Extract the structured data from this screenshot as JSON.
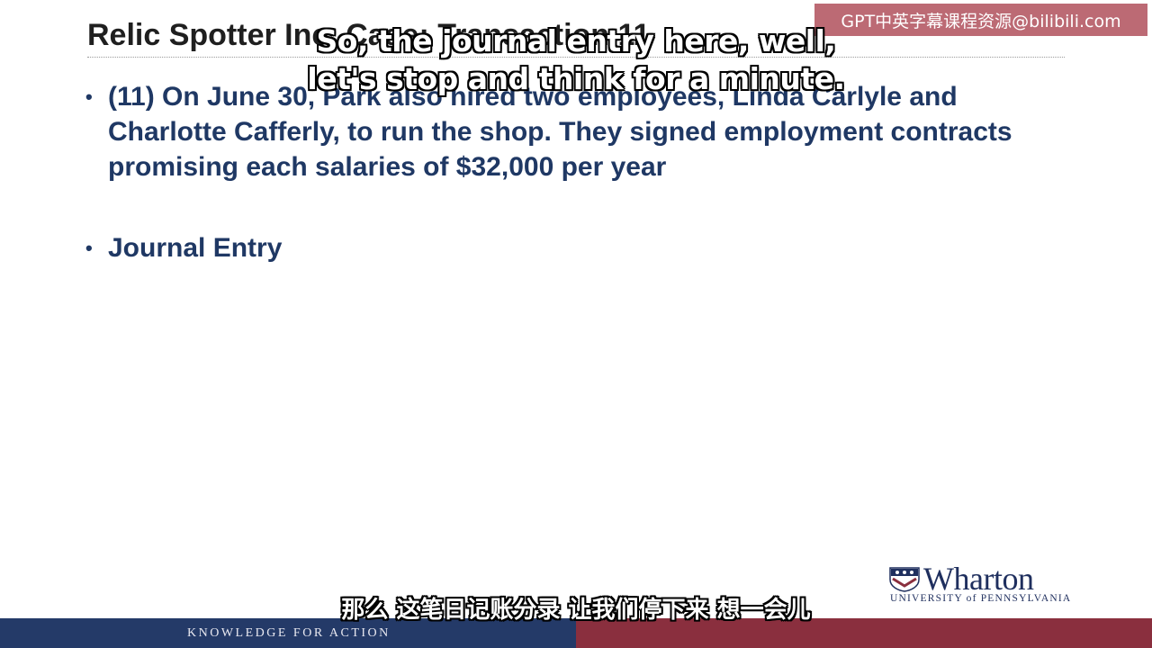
{
  "slide": {
    "title": "Relic Spotter Inc. Case: Transaction 11",
    "bullets": [
      "(11) On June 30, Park also hired two employees, Linda Carlyle and Charlotte Cafferly, to run the shop.  They signed employment contracts promising each salaries of $32,000 per year",
      "Journal Entry"
    ],
    "bullet_marker": "•"
  },
  "subtitles": {
    "english_line1": "So, the journal entry here, well,",
    "english_line2": "let's stop and think for a minute.",
    "chinese": "那么 这笔日记账分录 让我们停下来 想一会儿"
  },
  "watermark": {
    "text": "GPT中英字幕课程资源@bilibili.com"
  },
  "logo": {
    "name": "Wharton",
    "subtitle": "UNIVERSITY of PENNSYLVANIA",
    "icon": "penn-shield-icon"
  },
  "footer": {
    "tagline": "KNOWLEDGE FOR ACTION"
  },
  "colors": {
    "title": "#1f1f1f",
    "bullet_text": "#1f3864",
    "footer_blue": "#243a68",
    "footer_red": "#8a2f3e",
    "watermark_bg": "#b55a66"
  }
}
